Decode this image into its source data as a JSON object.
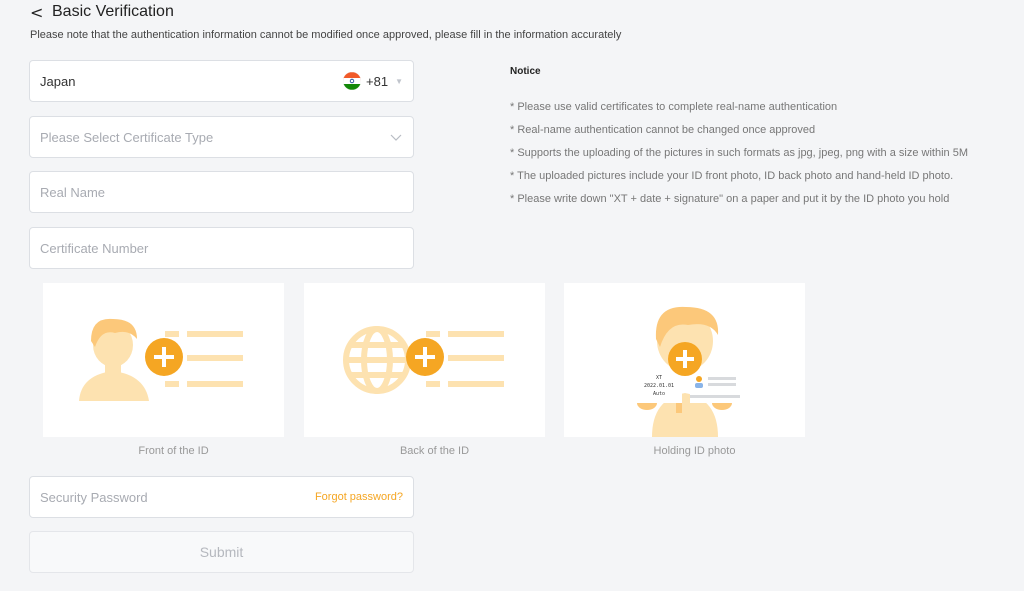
{
  "header": {
    "back_label": "<",
    "title": "Basic Verification"
  },
  "subtitle": "Please note that the authentication information cannot be modified once approved, please fill in the information accurately",
  "form": {
    "country": {
      "value": "Japan",
      "code": "+81"
    },
    "certificate_type": {
      "placeholder": "Please Select Certificate Type"
    },
    "real_name": {
      "placeholder": "Real Name"
    },
    "certificate_number": {
      "placeholder": "Certificate Number"
    },
    "security_password": {
      "placeholder": "Security Password",
      "forgot_label": "Forgot password?"
    },
    "submit_label": "Submit"
  },
  "notice": {
    "title": "Notice",
    "items": [
      "* Please use valid certificates to complete real-name authentication",
      "* Real-name authentication cannot be changed once approved",
      "* Supports the uploading of the pictures in such formats as jpg, jpeg, png with a size within 5M",
      "* The uploaded pictures include your ID front photo, ID back photo and hand-held ID photo.",
      "* Please write down \"XT + date + signature\" on a paper and put it by the ID photo you hold"
    ]
  },
  "uploads": [
    {
      "label": "Front of the ID"
    },
    {
      "label": "Back of the ID"
    },
    {
      "label": "Holding ID photo"
    }
  ],
  "holding_sample": {
    "line1": "XT",
    "line2": "2022.01.01",
    "line3": "Auto"
  },
  "colors": {
    "accent": "#f5a623",
    "illustration_light": "#fde2b0",
    "illustration_medium": "#fcc87a",
    "illustration_dark": "#f5a623"
  },
  "icons": {
    "plus": "plus-icon",
    "chevron": "chevron-down-icon",
    "back": "back-arrow-icon"
  }
}
